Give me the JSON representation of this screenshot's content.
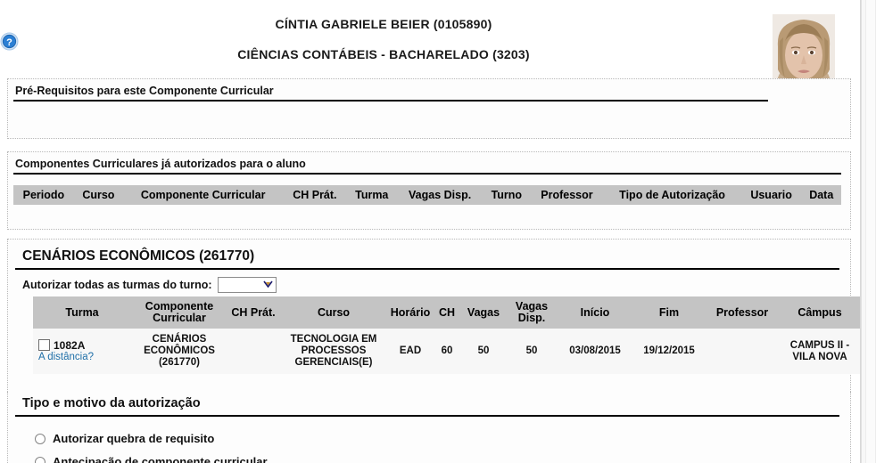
{
  "header": {
    "student_name": "CÍNTIA GABRIELE BEIER (0105890)",
    "student_course": "CIÊNCIAS CONTÁBEIS - BACHARELADO (3203)",
    "help_icon": "help-question-icon",
    "photo_alt": "student-photo"
  },
  "prerequisites": {
    "title": "Pré-Requisitos para este Componente Curricular"
  },
  "authorized": {
    "title": "Componentes Curriculares já autorizados para o aluno",
    "columns": [
      "Periodo",
      "Curso",
      "Componente Curricular",
      "CH Prát.",
      "Turma",
      "Vagas Disp.",
      "Turno",
      "Professor",
      "Tipo de Autorização",
      "Usuario",
      "Data"
    ],
    "rows": []
  },
  "component": {
    "title": "CENÁRIOS ECONÔMICOS (261770)",
    "turno_label": "Autorizar todas as turmas do turno:",
    "turno_value": "",
    "turno_options": [
      ""
    ],
    "columns": [
      "Turma",
      "Componente Curricular",
      "CH Prát.",
      "Curso",
      "Horário",
      "CH",
      "Vagas",
      "Vagas Disp.",
      "Início",
      "Fim",
      "Professor",
      "Câmpus"
    ],
    "rows": [
      {
        "turma": "1082A",
        "distancia_link": "A distância?",
        "checked": false,
        "componente": "CENÁRIOS ECONÔMICOS (261770)",
        "ch_prat": "",
        "curso": "TECNOLOGIA EM PROCESSOS GERENCIAIS(E)",
        "horario": "EAD",
        "ch": "60",
        "vagas": "50",
        "vagas_disp": "50",
        "inicio": "03/08/2015",
        "fim": "19/12/2015",
        "professor": "",
        "campus": "CAMPUS II - VILA NOVA"
      }
    ]
  },
  "tipo": {
    "title": "Tipo e motivo da autorização",
    "options": [
      {
        "label": "Autorizar quebra de requisito",
        "selected": false
      },
      {
        "label": "Antecipação de componente curricular",
        "selected": false
      }
    ]
  },
  "colors": {
    "table_header_bg": "#c4c4c4",
    "row_bg": "#f7f7f7",
    "link": "#1f6fa8",
    "help_blue": "#2b7fd4"
  }
}
